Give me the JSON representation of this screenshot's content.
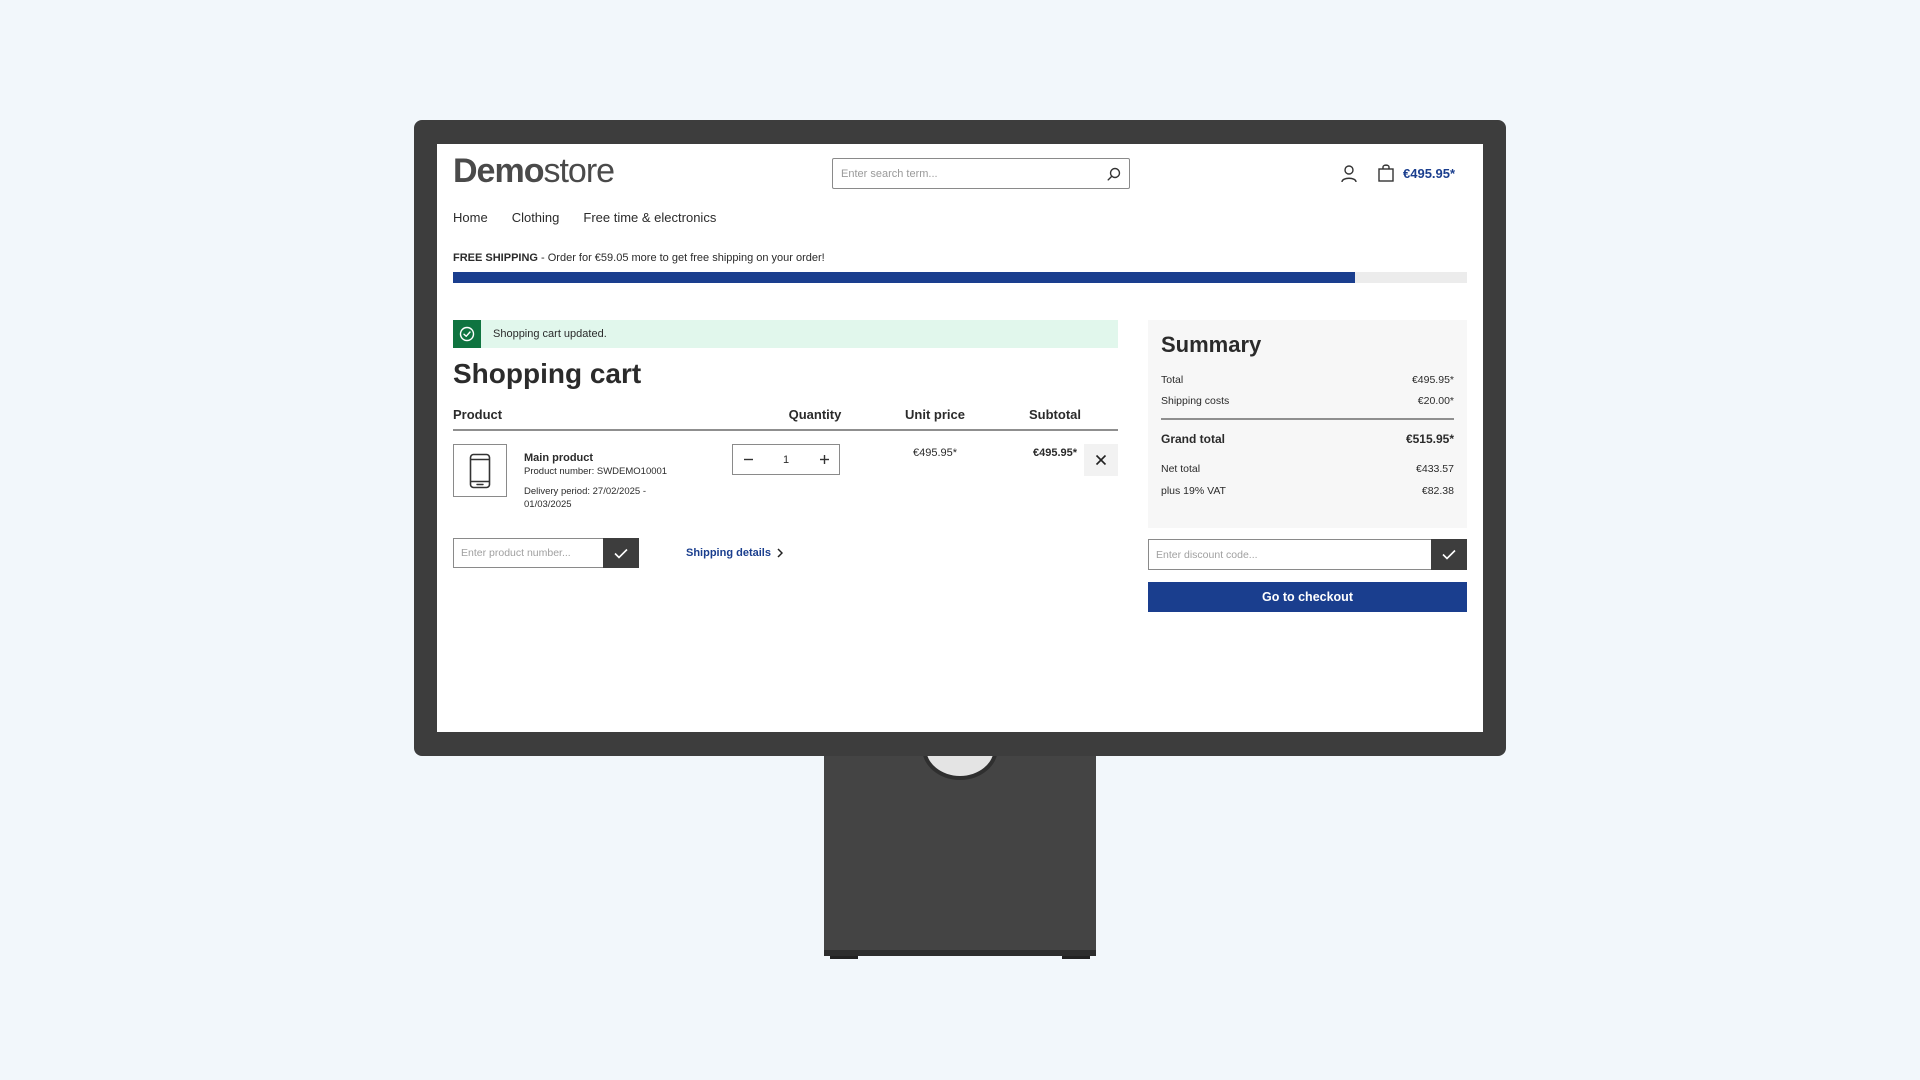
{
  "header": {
    "logo_bold": "Demo",
    "logo_regular": "store",
    "search_placeholder": "Enter search term...",
    "cart_total": "€495.95*"
  },
  "nav": {
    "items": [
      {
        "label": "Home"
      },
      {
        "label": "Clothing"
      },
      {
        "label": "Free time & electronics"
      }
    ]
  },
  "free_shipping": {
    "label": "FREE SHIPPING",
    "message": " - Order for €59.05 more to get free shipping on your order!",
    "progress_percent": 89
  },
  "alert": {
    "message": "Shopping cart updated."
  },
  "cart": {
    "title": "Shopping cart",
    "columns": {
      "product": "Product",
      "quantity": "Quantity",
      "unit_price": "Unit price",
      "subtotal": "Subtotal"
    },
    "items": [
      {
        "name": "Main product",
        "product_number": "Product number: SWDEMO10001",
        "delivery_period": "Delivery period: 27/02/2025 - 01/03/2025",
        "quantity": "1",
        "unit_price": "€495.95*",
        "subtotal": "€495.95*"
      }
    ],
    "product_number_placeholder": "Enter product number...",
    "shipping_details_label": "Shipping details"
  },
  "summary": {
    "title": "Summary",
    "total_label": "Total",
    "total_value": "€495.95*",
    "shipping_label": "Shipping costs",
    "shipping_value": "€20.00*",
    "grand_total_label": "Grand total",
    "grand_total_value": "€515.95*",
    "net_total_label": "Net total",
    "net_total_value": "€433.57",
    "vat_label": "plus 19% VAT",
    "vat_value": "€82.38",
    "discount_placeholder": "Enter discount code...",
    "checkout_label": "Go to checkout"
  },
  "colors": {
    "accent": "#1a3e8e",
    "success": "#0f7440",
    "success_bg": "#e1f7ec",
    "bezel": "#3d3d3d",
    "page_bg": "#f2f7fb"
  }
}
